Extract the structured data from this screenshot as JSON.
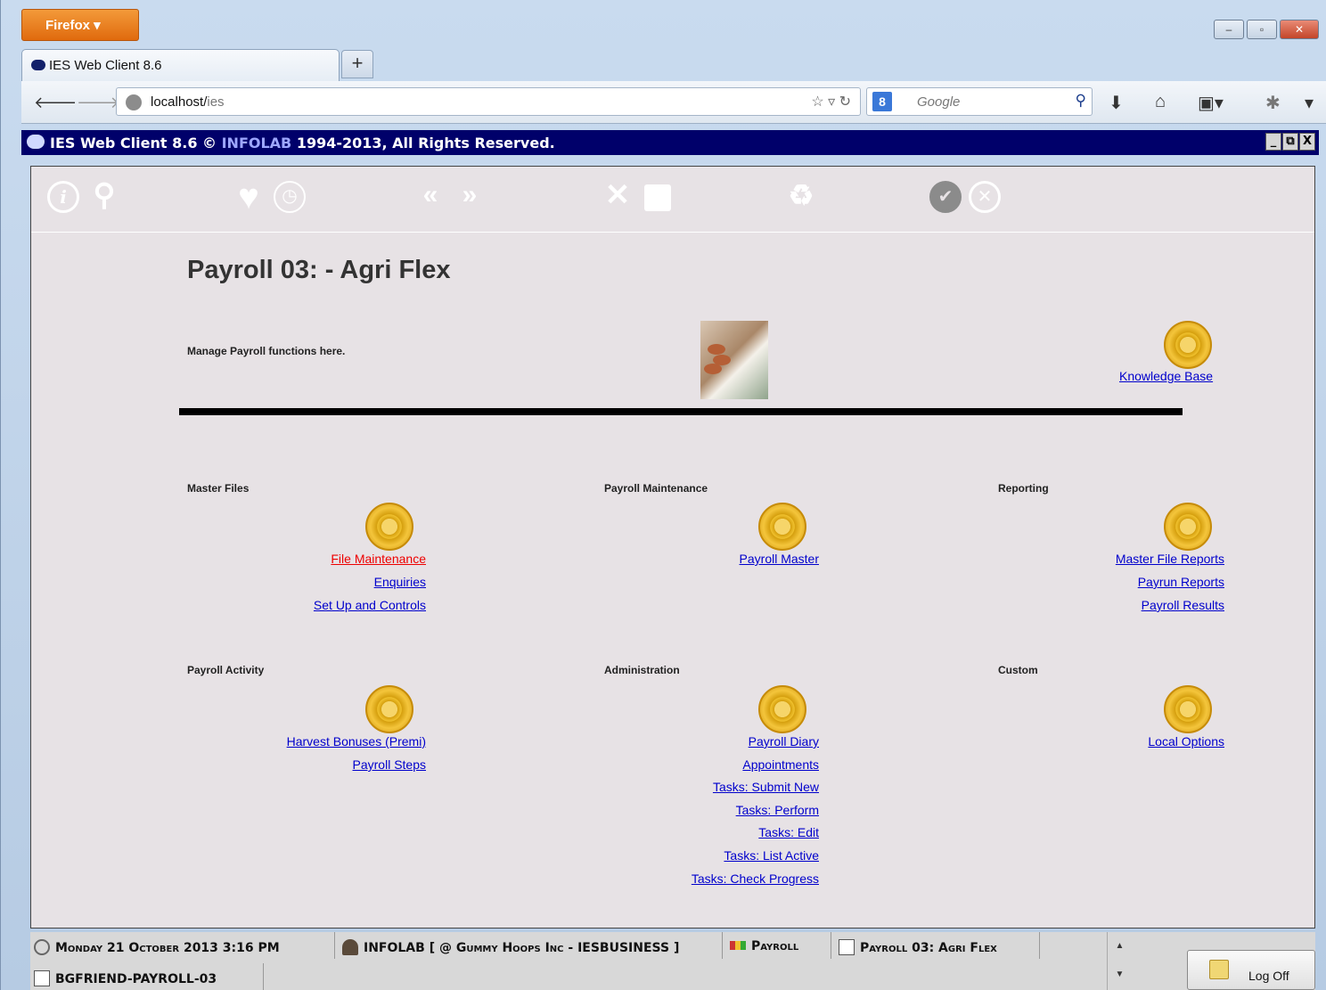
{
  "browser": {
    "menu_label": "Firefox ▾",
    "tab_title": "IES Web Client 8.6",
    "new_tab": "+",
    "url_host": "localhost/",
    "url_path": "ies",
    "search_placeholder": "Google",
    "search_engine_glyph": "8",
    "window_controls": [
      "–",
      "▫",
      "✕"
    ]
  },
  "app": {
    "title_prefix": "IES Web Client 8.6 © ",
    "title_brand": "INFOLAB",
    "title_suffix": " 1994-2013, All Rights Reserved.",
    "title_controls": [
      "_",
      "⧉",
      "X"
    ]
  },
  "toolbar": {
    "icons": [
      "info-icon",
      "search-icon",
      "favourite-icon",
      "clock-icon",
      "back-icon",
      "forward-icon",
      "tools-icon",
      "window-icon",
      "recycle-icon",
      "accept-icon",
      "cancel-icon"
    ]
  },
  "page": {
    "title": "Payroll 03: - Agri Flex",
    "description": "Manage Payroll functions here.",
    "knowledge_base": "Knowledge Base"
  },
  "sections": {
    "master_files": {
      "heading": "Master Files",
      "links": [
        "File Maintenance",
        "Enquiries",
        "Set Up and Controls"
      ]
    },
    "payroll_maintenance": {
      "heading": "Payroll Maintenance",
      "links": [
        "Payroll Master"
      ]
    },
    "reporting": {
      "heading": "Reporting",
      "links": [
        "Master File Reports",
        "Payrun Reports",
        "Payroll Results"
      ]
    },
    "payroll_activity": {
      "heading": "Payroll Activity",
      "links": [
        "Harvest Bonuses (Premi)",
        "Payroll Steps"
      ]
    },
    "administration": {
      "heading": "Administration",
      "links": [
        "Payroll Diary",
        "Appointments",
        "Tasks: Submit New",
        "Tasks: Perform",
        "Tasks: Edit",
        "Tasks: List Active",
        "Tasks: Check Progress"
      ]
    },
    "custom": {
      "heading": "Custom",
      "links": [
        "Local Options"
      ]
    }
  },
  "status_bar": {
    "datetime": "Monday 21 October 2013 3:16 PM",
    "user": "INFOLAB [ @ Gummy Hoops Inc - IESBUSINESS ]",
    "module": "Payroll",
    "document": "Payroll 03: Agri Flex",
    "session": "BGFRIEND-PAYROLL-03",
    "logoff": "Log Off"
  },
  "colors": {
    "title_bar": "#00006a",
    "link": "#0000cc",
    "active_link": "#ee0000",
    "page_bg": "#e7e2e5"
  }
}
